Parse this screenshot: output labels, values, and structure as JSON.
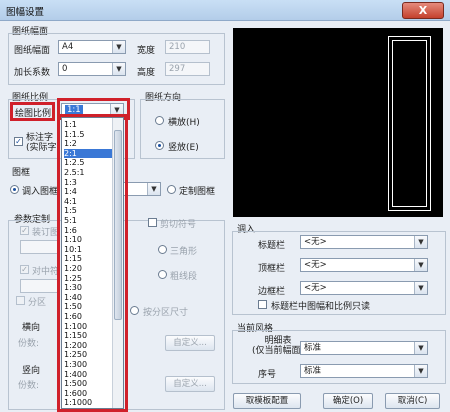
{
  "window": {
    "title": "图幅设置",
    "close_glyph": "X"
  },
  "paper_frame": {
    "group_title": "图纸幅面",
    "size_label": "图纸幅面",
    "size_value": "A4",
    "width_label": "宽度",
    "width_value": "210",
    "scale_coef_label": "加长系数",
    "scale_coef_value": "0",
    "height_label": "高度",
    "height_value": "297"
  },
  "scale": {
    "group_title": "图纸比例",
    "drawing_scale_label": "绘图比例",
    "drawing_scale_value": "1:1",
    "annotation_check_line1": "标注字",
    "annotation_check_line2": "(实际字"
  },
  "orientation": {
    "group_title": "图纸方向",
    "landscape": "横放(H)",
    "portrait": "竖放(E)"
  },
  "frame": {
    "group_title": "图框",
    "load_frame": "调入图框",
    "load_frame_suffix": "S)",
    "custom_frame": "定制图框"
  },
  "params": {
    "group_title": "参数定制",
    "binding_check": "装订图",
    "center_check": "对中符",
    "cut_mark": "剪切符号",
    "triangle": "三角形",
    "thick_line": "粗线段",
    "zone_check": "分区",
    "by_zone_size": "按分区尺寸",
    "horizontal": "横向",
    "vertical": "竖向",
    "count_label": "份数:",
    "custom_btn": "自定义..."
  },
  "load": {
    "group_title": "调入",
    "title_bar_label": "标题栏",
    "title_bar_value": "<无>",
    "top_bar_label": "顶框栏",
    "top_bar_value": "<无>",
    "side_bar_label": "边框栏",
    "side_bar_value": "<无>",
    "readonly_check": "标题栏中图幅和比例只读"
  },
  "style": {
    "group_title": "当前风格",
    "detail_label_line1": "明细表",
    "detail_label_line2": "(仅当前幅面)",
    "detail_value": "标准",
    "serial_label": "序号",
    "serial_value": "标准"
  },
  "buttons": {
    "template": "取模板配置",
    "ok": "确定(O)",
    "cancel": "取消(C)"
  },
  "scale_options": [
    "1:1",
    "1:1.5",
    "1:2",
    "2:1",
    "1:2.5",
    "2.5:1",
    "1:3",
    "1:4",
    "4:1",
    "1:5",
    "5:1",
    "1:6",
    "1:10",
    "10:1",
    "1:15",
    "1:20",
    "1:25",
    "1:30",
    "1:40",
    "1:50",
    "1:60",
    "1:100",
    "1:150",
    "1:200",
    "1:250",
    "1:300",
    "1:400",
    "1:500",
    "1:600",
    "1:1000"
  ],
  "selected_option": "2:1",
  "colors": {
    "highlight_red": "#d0202a",
    "selection_blue": "#3a78d6",
    "preview_bg": "#000000"
  }
}
